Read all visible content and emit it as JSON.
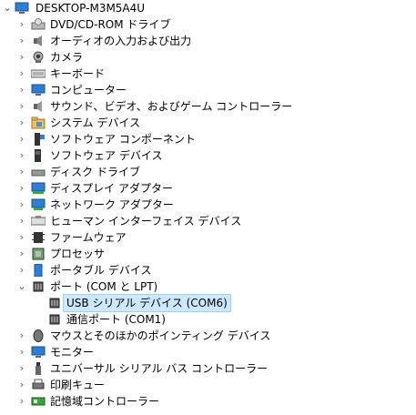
{
  "tree": {
    "root": {
      "label": "DESKTOP-M3M5A4U",
      "icon": "computer-icon",
      "expanded": true
    },
    "chevron_collapsed": "›",
    "chevron_expanded": "⌄",
    "items": [
      {
        "label": "DVD/CD-ROM ドライブ",
        "icon": "dvd-drive-icon"
      },
      {
        "label": "オーディオの入力および出力",
        "icon": "speaker-icon"
      },
      {
        "label": "カメラ",
        "icon": "camera-icon"
      },
      {
        "label": "キーボード",
        "icon": "keyboard-icon"
      },
      {
        "label": "コンピューター",
        "icon": "monitor-icon"
      },
      {
        "label": "サウンド、ビデオ、およびゲーム コントローラー",
        "icon": "sound-icon"
      },
      {
        "label": "システム デバイス",
        "icon": "system-folder-icon"
      },
      {
        "label": "ソフトウェア コンポーネント",
        "icon": "software-component-icon"
      },
      {
        "label": "ソフトウェア デバイス",
        "icon": "software-device-icon"
      },
      {
        "label": "ディスク ドライブ",
        "icon": "disk-drive-icon"
      },
      {
        "label": "ディスプレイ アダプター",
        "icon": "display-adapter-icon"
      },
      {
        "label": "ネットワーク アダプター",
        "icon": "network-adapter-icon"
      },
      {
        "label": "ヒューマン インターフェイス デバイス",
        "icon": "hid-icon"
      },
      {
        "label": "ファームウェア",
        "icon": "firmware-icon"
      },
      {
        "label": "プロセッサ",
        "icon": "processor-icon"
      },
      {
        "label": "ポータブル デバイス",
        "icon": "portable-device-icon"
      },
      {
        "label": "ポート (COM と LPT)",
        "icon": "port-icon",
        "expanded": true,
        "children": [
          {
            "label": "USB シリアル デバイス (COM6)",
            "icon": "port-icon",
            "selected": true
          },
          {
            "label": "通信ポート (COM1)",
            "icon": "port-icon"
          }
        ]
      },
      {
        "label": "マウスとそのほかのポインティング デバイス",
        "icon": "mouse-icon"
      },
      {
        "label": "モニター",
        "icon": "monitor-icon"
      },
      {
        "label": "ユニバーサル シリアル バス コントローラー",
        "icon": "usb-icon"
      },
      {
        "label": "印刷キュー",
        "icon": "printer-icon"
      },
      {
        "label": "記憶域コントローラー",
        "icon": "storage-controller-icon"
      }
    ]
  }
}
